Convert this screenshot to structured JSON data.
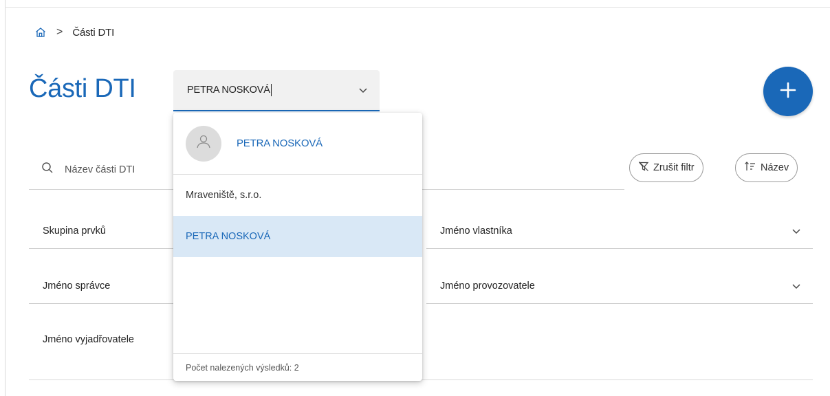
{
  "breadcrumb": {
    "home_icon": "home-icon",
    "separator": ">",
    "current": "Části DTI"
  },
  "page": {
    "title": "Části DTI"
  },
  "owner_select": {
    "value": "PETRA NOSKOVÁ",
    "icon": "chevron-down-icon"
  },
  "fab": {
    "icon": "plus-icon"
  },
  "search": {
    "placeholder": "Název části DTI",
    "icon": "search-icon"
  },
  "toolbar": {
    "clear_filter_label": "Zrušit filtr",
    "clear_filter_icon": "filter-off-icon",
    "sort_label": "Název",
    "sort_icon": "sort-icon"
  },
  "filters": {
    "skupina": "Skupina prvků",
    "vlastnik": "Jméno vlastníka",
    "spravce": "Jméno správce",
    "provozovatel": "Jméno provozovatele",
    "vyjadrovatel": "Jméno vyjadřovatele"
  },
  "dropdown": {
    "header_name": "PETRA NOSKOVÁ",
    "items": [
      {
        "label": "Mraveniště, s.r.o."
      },
      {
        "label": "PETRA NOSKOVÁ"
      }
    ],
    "selected_index": 1,
    "footer": "Počet nalezených výsledků: 2"
  },
  "colors": {
    "accent": "#1a68b8",
    "selected_bg": "#d9e8f6",
    "input_bg": "#f1f1f1"
  }
}
